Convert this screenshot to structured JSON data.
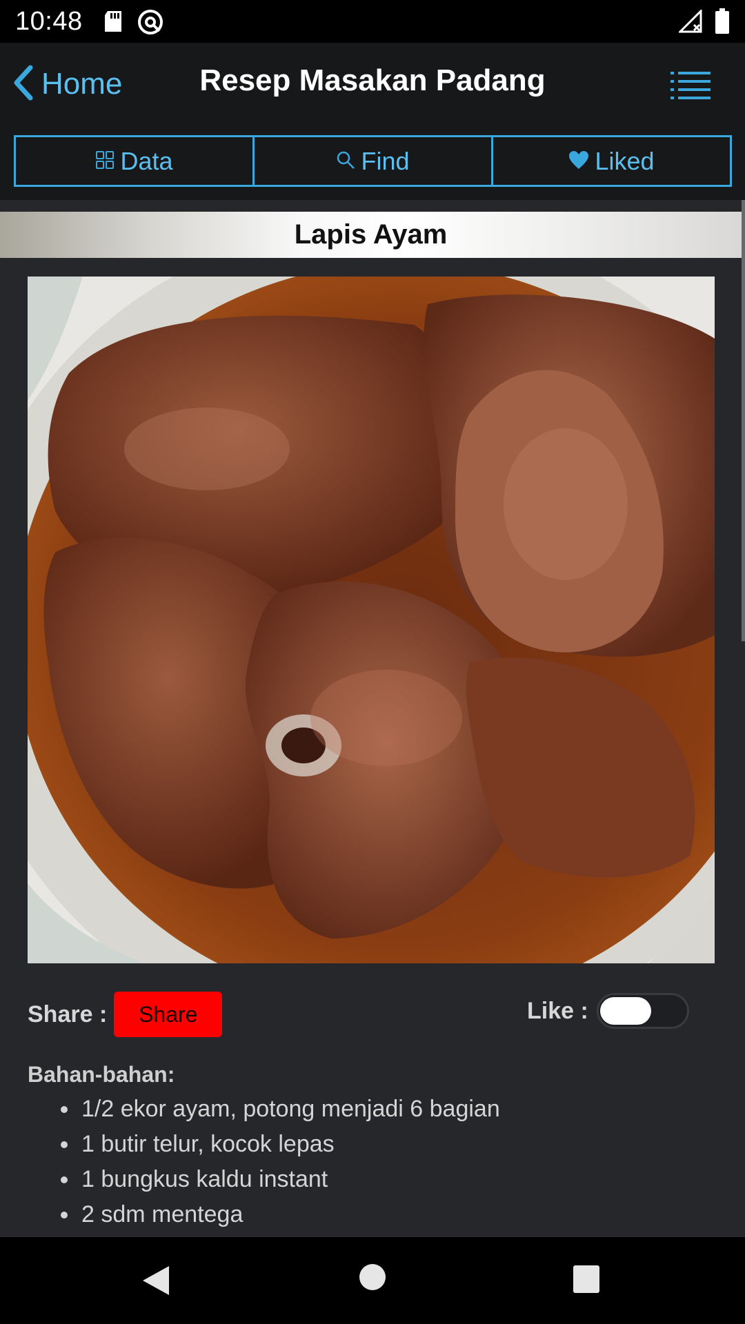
{
  "status_bar": {
    "time": "10:48",
    "icons": [
      "sd-card-icon",
      "sync-icon",
      "signal-icon",
      "battery-icon"
    ]
  },
  "app_bar": {
    "back_label": "Home",
    "title": "Resep Masakan Padang",
    "menu_icon": "list-menu-icon"
  },
  "tabs": [
    {
      "label": "Data",
      "icon": "grid-icon"
    },
    {
      "label": "Find",
      "icon": "search-icon"
    },
    {
      "label": "Liked",
      "icon": "heart-icon"
    }
  ],
  "recipe": {
    "name": "Lapis Ayam",
    "share_label": "Share :",
    "share_button": "Share",
    "like_label": "Like :",
    "liked": false,
    "ingredients_title": "Bahan-bahan:",
    "ingredients": [
      "1/2 ekor ayam, potong menjadi 6 bagian",
      "1 butir telur, kocok lepas",
      "1 bungkus kaldu instant",
      "2 sdm mentega"
    ]
  },
  "colors": {
    "accent": "#3aa7dd",
    "share_button": "#ff0000",
    "content_bg": "#25272b",
    "bar_bg": "#17181a"
  }
}
